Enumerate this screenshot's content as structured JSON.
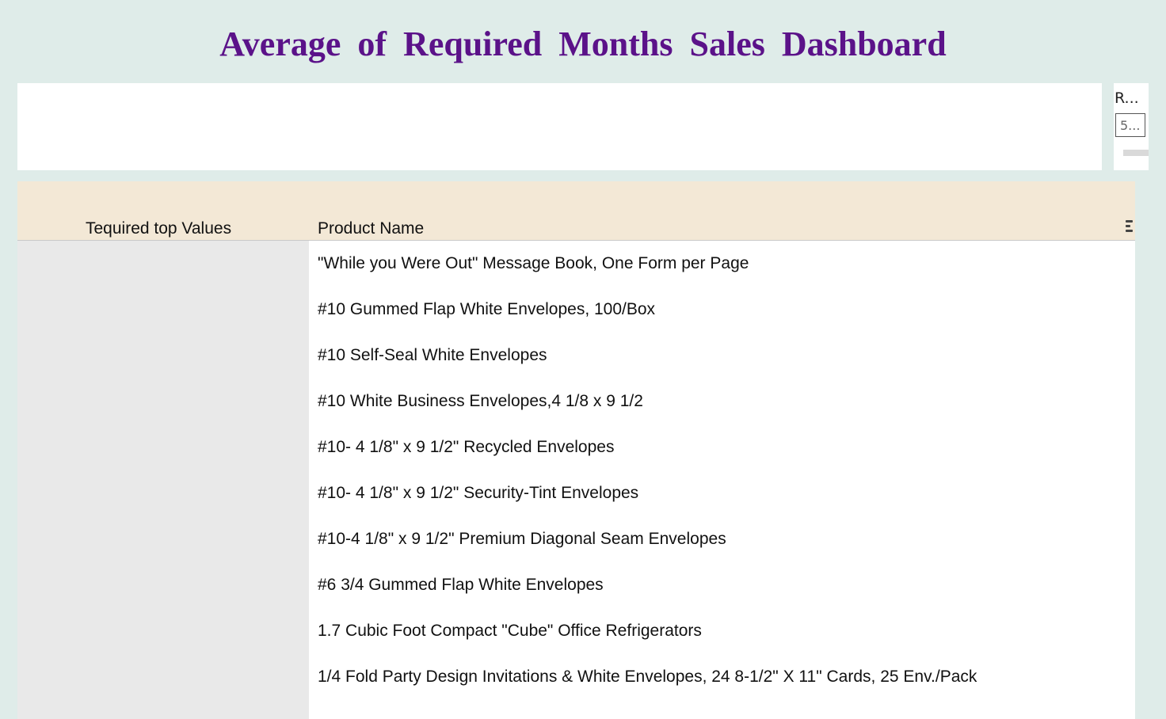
{
  "title": "Average  of  Required  Months  Sales  Dashboard",
  "filter": {
    "label": "R...",
    "input_value": "5..."
  },
  "table": {
    "columns": [
      "Tequired top Values",
      "Product Name"
    ],
    "rows": [
      "\"While you Were Out\" Message Book, One Form per Page",
      "#10 Gummed Flap White Envelopes, 100/Box",
      "#10 Self-Seal White Envelopes",
      "#10 White Business Envelopes,4 1/8 x 9 1/2",
      "#10- 4 1/8\" x 9 1/2\" Recycled Envelopes",
      "#10- 4 1/8\" x 9 1/2\" Security-Tint Envelopes",
      "#10-4 1/8\" x 9 1/2\" Premium Diagonal Seam Envelopes",
      "#6 3/4 Gummed Flap White Envelopes",
      "1.7 Cubic Foot Compact \"Cube\" Office Refrigerators",
      "1/4 Fold Party Design Invitations & White Envelopes, 24 8-1/2\" X 11\" Cards, 25 Env./Pack"
    ]
  },
  "colors": {
    "background": "#dfece9",
    "title": "#5b1289",
    "header": "#f3e8d6",
    "left_column": "#e9e9e9"
  },
  "icons": {
    "table_menu": "menu-lines-icon"
  }
}
